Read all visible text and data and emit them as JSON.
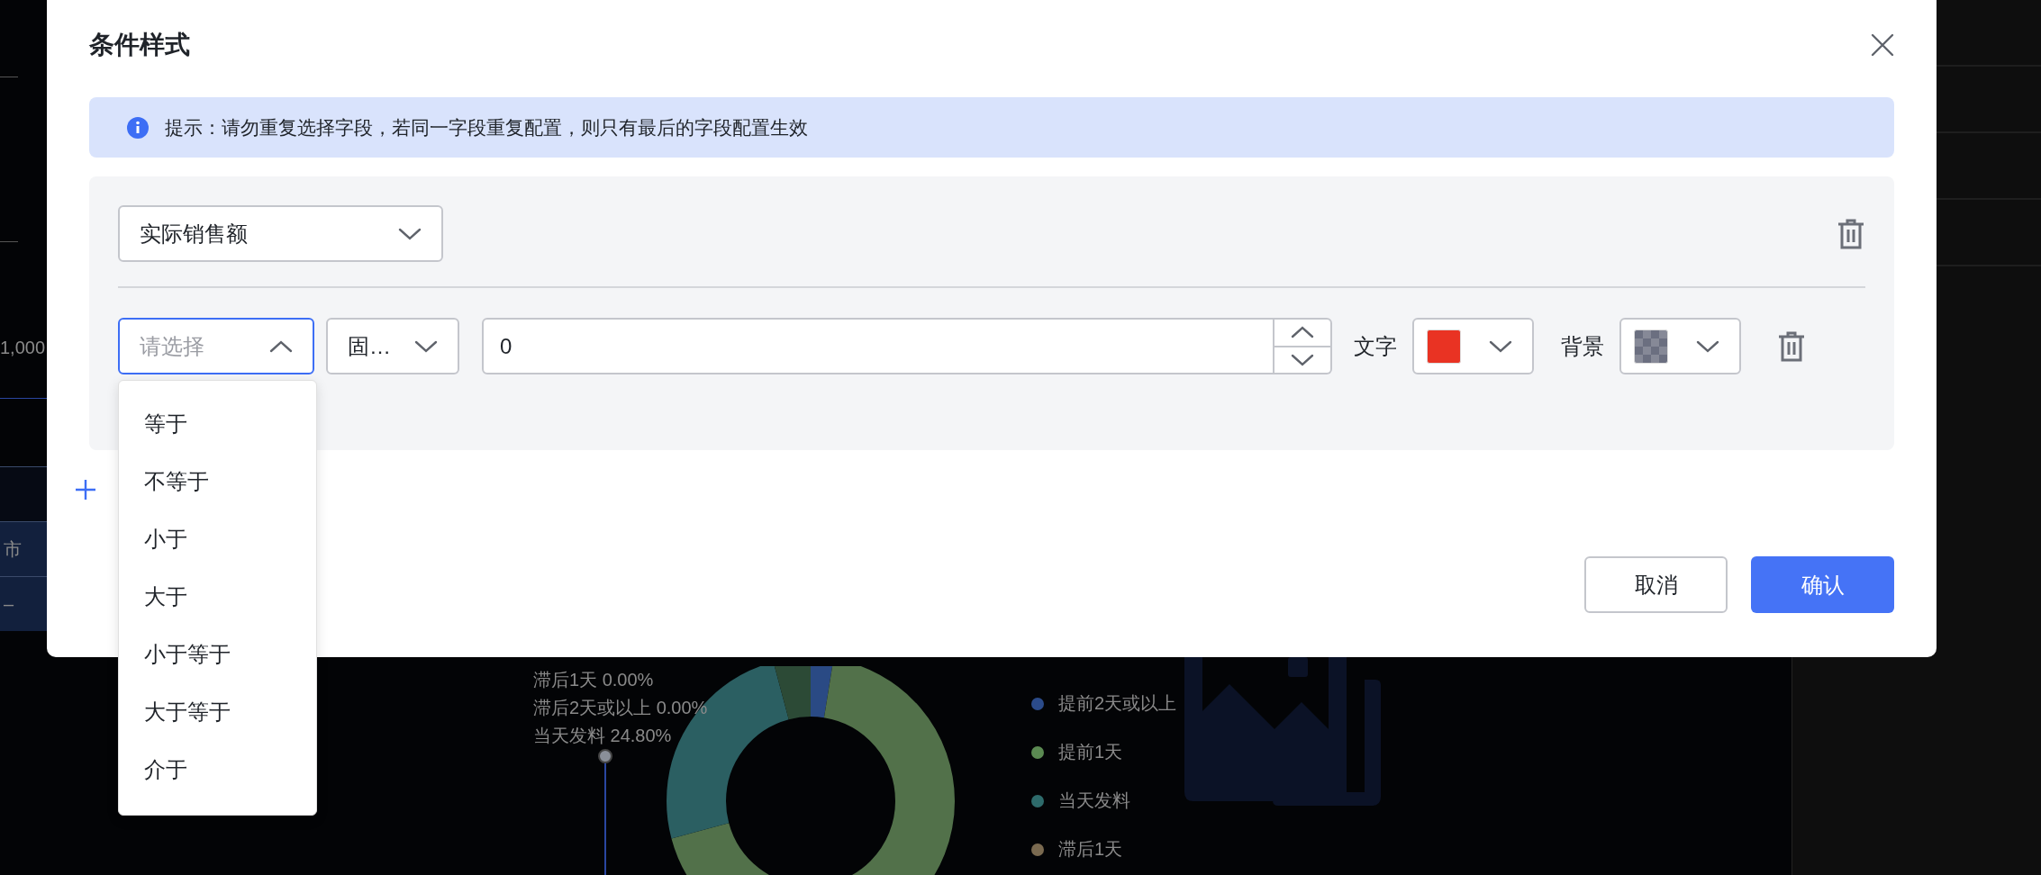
{
  "dialog": {
    "title": "条件样式",
    "notice": {
      "text": "提示：请勿重复选择字段，若同一字段重复配置，则只有最后的字段配置生效"
    },
    "rules": [
      {
        "field": {
          "value": "实际销售额",
          "expanded": false
        },
        "conditions": [
          {
            "operator": {
              "placeholder": "请选择",
              "expanded": true
            },
            "mode": {
              "value": "固…",
              "expanded": false
            },
            "number": {
              "value": "0"
            },
            "text_color": {
              "label": "文字",
              "color": "#e93323"
            },
            "background_color": {
              "label": "背景",
              "color": "#6b6f80"
            }
          }
        ]
      }
    ],
    "operator_options": [
      {
        "label": "等于",
        "selected": false
      },
      {
        "label": "不等于",
        "selected": false
      },
      {
        "label": "小于",
        "selected": false
      },
      {
        "label": "大于",
        "selected": false
      },
      {
        "label": "小于等于",
        "selected": false
      },
      {
        "label": "大于等于",
        "selected": false
      },
      {
        "label": "介于",
        "selected": false
      }
    ],
    "buttons": [
      {
        "label": "取消",
        "kind": "secondary"
      },
      {
        "label": "确认",
        "kind": "primary"
      }
    ]
  },
  "background": {
    "left_texts": [
      "1,000",
      "市",
      "–"
    ],
    "chart_labels": [
      "滞后1天 0.00%",
      "滞后2天或以上 0.00%",
      "当天发料 24.80%"
    ],
    "legend": [
      {
        "label": "提前2天或以上",
        "color": "#2b4b8a"
      },
      {
        "label": "提前1天",
        "color": "#5b8a52"
      },
      {
        "label": "当天发料",
        "color": "#2e6b6b"
      },
      {
        "label": "滞后1天",
        "color": "#7a6a50"
      }
    ]
  }
}
